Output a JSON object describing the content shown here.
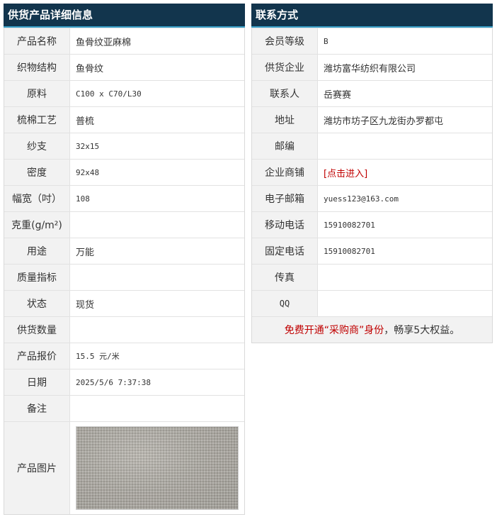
{
  "product_panel": {
    "title": "供货产品详细信息",
    "rows": [
      {
        "label": "产品名称",
        "value": "鱼骨纹亚麻棉"
      },
      {
        "label": "织物结构",
        "value": "鱼骨纹"
      },
      {
        "label": "原料",
        "value": "C100 x C70/L30"
      },
      {
        "label": "梳棉工艺",
        "value": "普梳"
      },
      {
        "label": "纱支",
        "value": "32x15"
      },
      {
        "label": "密度",
        "value": "92x48"
      },
      {
        "label": "幅宽（吋）",
        "value": "108"
      },
      {
        "label": "克重(g/m²)",
        "value": ""
      },
      {
        "label": "用途",
        "value": "万能"
      },
      {
        "label": "质量指标",
        "value": ""
      },
      {
        "label": "状态",
        "value": "现货"
      },
      {
        "label": "供货数量",
        "value": ""
      },
      {
        "label": "产品报价",
        "value": "15.5 元/米"
      },
      {
        "label": "日期",
        "value": "2025/5/6 7:37:38"
      },
      {
        "label": "备注",
        "value": ""
      }
    ],
    "image_label": "产品图片"
  },
  "contact_panel": {
    "title": "联系方式",
    "rows": [
      {
        "label": "会员等级",
        "value": "B"
      },
      {
        "label": "供货企业",
        "value": "潍坊富华纺织有限公司"
      },
      {
        "label": "联系人",
        "value": "岳赛赛"
      },
      {
        "label": "地址",
        "value": "潍坊市坊子区九龙街办罗都屯"
      },
      {
        "label": "邮编",
        "value": ""
      },
      {
        "label": "企业商铺",
        "value": "[点击进入]"
      },
      {
        "label": "电子邮箱",
        "value": "yuess123@163.com"
      },
      {
        "label": "移动电话",
        "value": "15910082701"
      },
      {
        "label": "固定电话",
        "value": "15910082701"
      },
      {
        "label": "传真",
        "value": ""
      },
      {
        "label": "QQ",
        "value": ""
      }
    ],
    "promo": {
      "part1": "免费开通“采购商”身份",
      "part2": "，畅享5大权益。"
    }
  },
  "colors": {
    "header_bg": "#12354d",
    "header_underline": "#3aa0c8",
    "label_bg": "#f2f2f2",
    "accent_red": "#c00000"
  }
}
